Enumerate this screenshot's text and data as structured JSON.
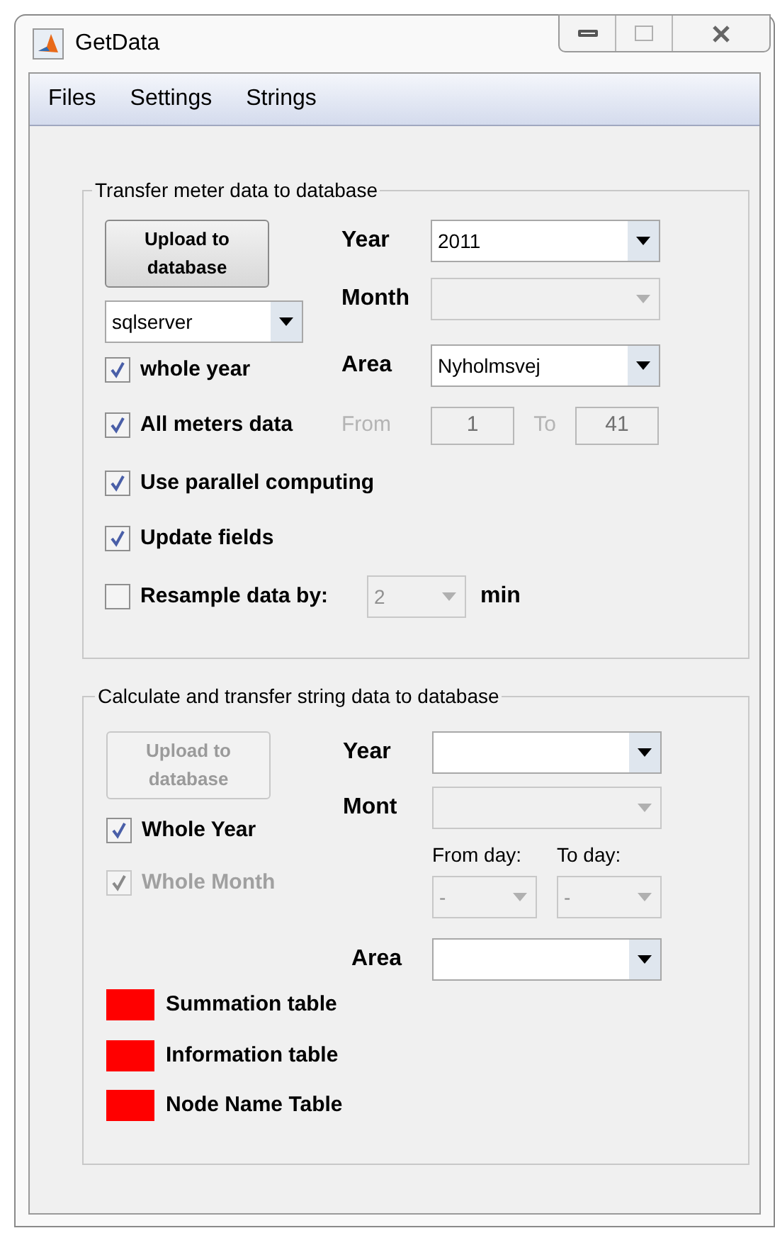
{
  "window": {
    "title": "GetData"
  },
  "menu": [
    "Files",
    "Settings",
    "Strings"
  ],
  "meter_panel": {
    "title": "Transfer meter data to database",
    "upload_button": {
      "label": "Upload to database",
      "disabled": false
    },
    "db_dropdown": {
      "value": "sqlserver",
      "disabled": false
    },
    "year": {
      "label": "Year",
      "value": "2011",
      "disabled": false
    },
    "month": {
      "label": "Month",
      "disabled": true
    },
    "area": {
      "label": "Area",
      "value": "Nyholmsvej",
      "disabled": false
    },
    "range": {
      "from_label": "From",
      "from": "1",
      "to_label": "To",
      "to": "41",
      "disabled": true
    },
    "checkboxes": [
      {
        "label": "whole year",
        "checked": true,
        "disabled": false
      },
      {
        "label": "All meters data",
        "checked": true,
        "disabled": false
      },
      {
        "label": "Use parallel computing",
        "checked": true,
        "disabled": false
      },
      {
        "label": "Update fields",
        "checked": true,
        "disabled": false
      }
    ],
    "resample": {
      "label": "Resample data by:",
      "checked": false,
      "value": "2",
      "disabled": true,
      "unit": "min"
    }
  },
  "string_panel": {
    "title": "Calculate and transfer string data to database",
    "upload_button": {
      "label": "Upload to database",
      "disabled": true
    },
    "year": {
      "label": "Year",
      "disabled": false
    },
    "month": {
      "label": "Mont",
      "disabled": true
    },
    "from_day": {
      "label": "From day:",
      "value": "-",
      "disabled": true
    },
    "to_day": {
      "label": "To day:",
      "value": "-",
      "disabled": true
    },
    "area": {
      "label": "Area",
      "disabled": false
    },
    "checkboxes": [
      {
        "label": "Whole Year",
        "checked": true,
        "disabled": false
      },
      {
        "label": "Whole Month",
        "checked": true,
        "disabled": true
      }
    ],
    "tables": [
      {
        "label": "Summation table",
        "color": "#ff0000"
      },
      {
        "label": "Information table",
        "color": "#ff0000"
      },
      {
        "label": "Node Name Table",
        "color": "#ff0000"
      }
    ]
  }
}
